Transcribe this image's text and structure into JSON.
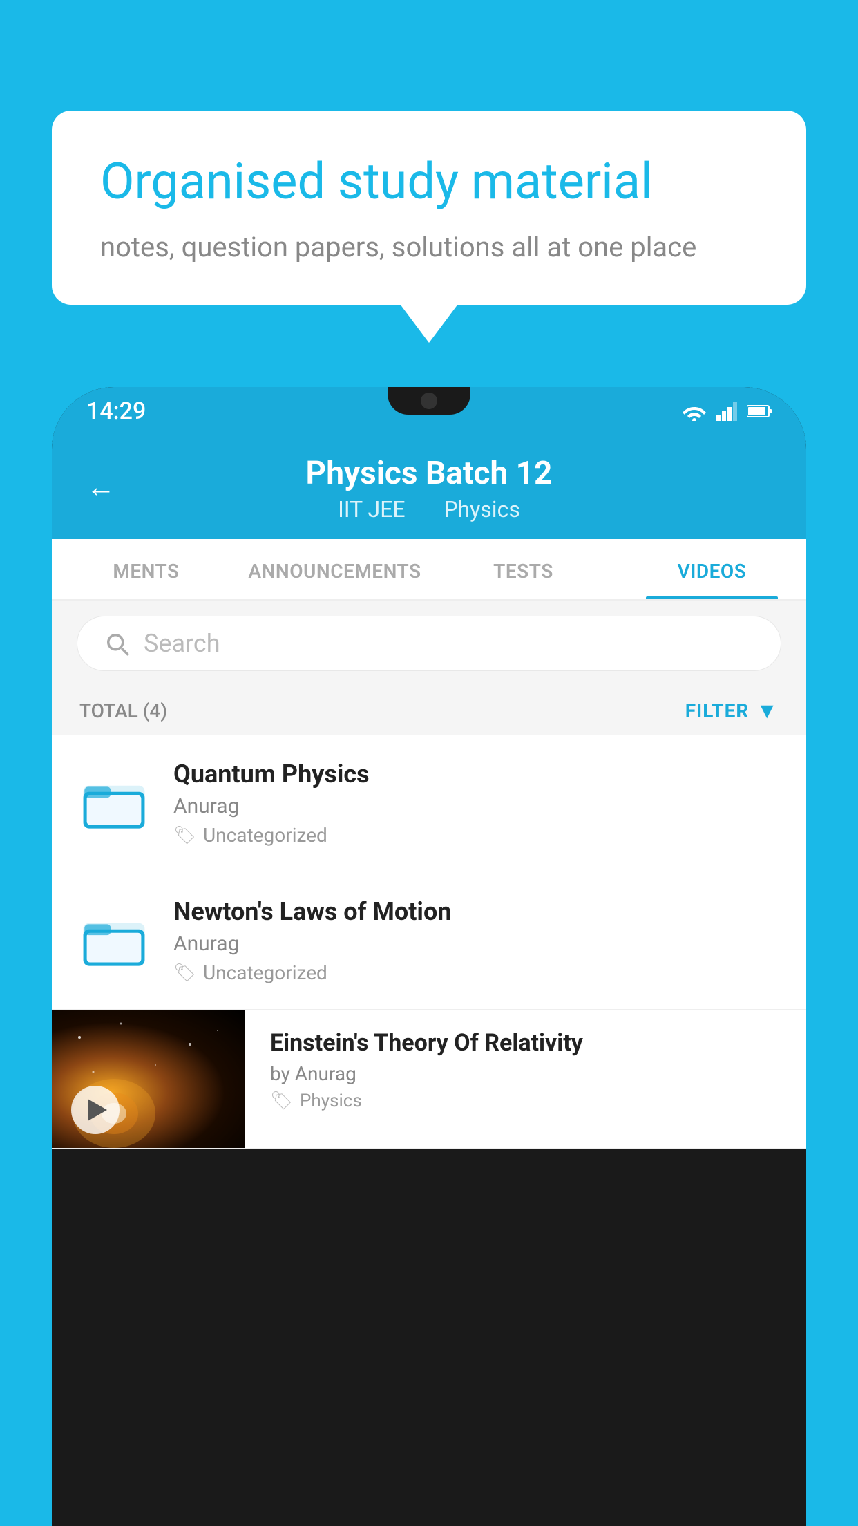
{
  "background_color": "#1ab9e8",
  "speech_bubble": {
    "title": "Organised study material",
    "subtitle": "notes, question papers, solutions all at one place"
  },
  "status_bar": {
    "time": "14:29",
    "icons": [
      "wifi",
      "signal",
      "battery"
    ]
  },
  "app_header": {
    "title": "Physics Batch 12",
    "sub1": "IIT JEE",
    "sub2": "Physics",
    "back_label": "←"
  },
  "tabs": [
    {
      "label": "MENTS",
      "active": false
    },
    {
      "label": "ANNOUNCEMENTS",
      "active": false
    },
    {
      "label": "TESTS",
      "active": false
    },
    {
      "label": "VIDEOS",
      "active": true
    }
  ],
  "search": {
    "placeholder": "Search"
  },
  "filter_row": {
    "total_label": "TOTAL (4)",
    "filter_label": "FILTER"
  },
  "videos": [
    {
      "title": "Quantum Physics",
      "author": "Anurag",
      "tag": "Uncategorized",
      "type": "folder"
    },
    {
      "title": "Newton's Laws of Motion",
      "author": "Anurag",
      "tag": "Uncategorized",
      "type": "folder"
    },
    {
      "title": "Einstein's Theory Of Relativity",
      "author": "by Anurag",
      "tag": "Physics",
      "type": "video"
    }
  ]
}
